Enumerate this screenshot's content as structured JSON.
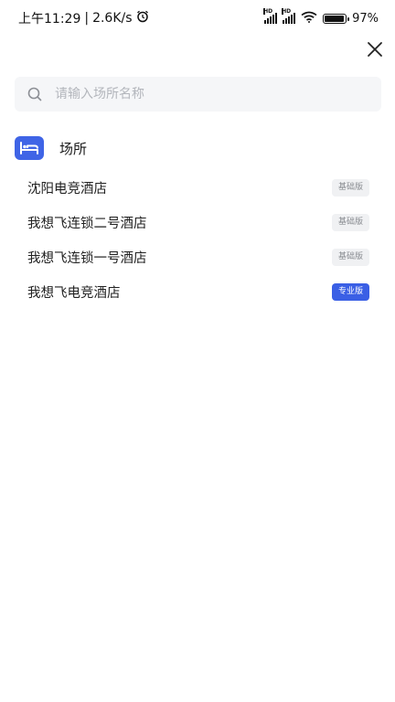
{
  "status_bar": {
    "time": "上午11:29",
    "separator": "|",
    "speed": "2.6K/s",
    "battery": "97%"
  },
  "search": {
    "placeholder": "请输入场所名称"
  },
  "section": {
    "title": "场所"
  },
  "venues": [
    {
      "name": "沈阳电竞酒店",
      "badge": "基础版",
      "tier": "basic"
    },
    {
      "name": "我想飞连锁二号酒店",
      "badge": "基础版",
      "tier": "basic"
    },
    {
      "name": "我想飞连锁一号酒店",
      "badge": "基础版",
      "tier": "basic"
    },
    {
      "name": "我想飞电竞酒店",
      "badge": "专业版",
      "tier": "pro"
    }
  ],
  "colors": {
    "accent": "#3f64e6",
    "badge_basic_bg": "#f0f1f3",
    "badge_pro_bg": "#3a5fe5"
  },
  "icons": [
    "alarm-icon",
    "signal-icon",
    "wifi-icon",
    "battery-icon",
    "close-icon",
    "search-icon",
    "bed-icon"
  ]
}
